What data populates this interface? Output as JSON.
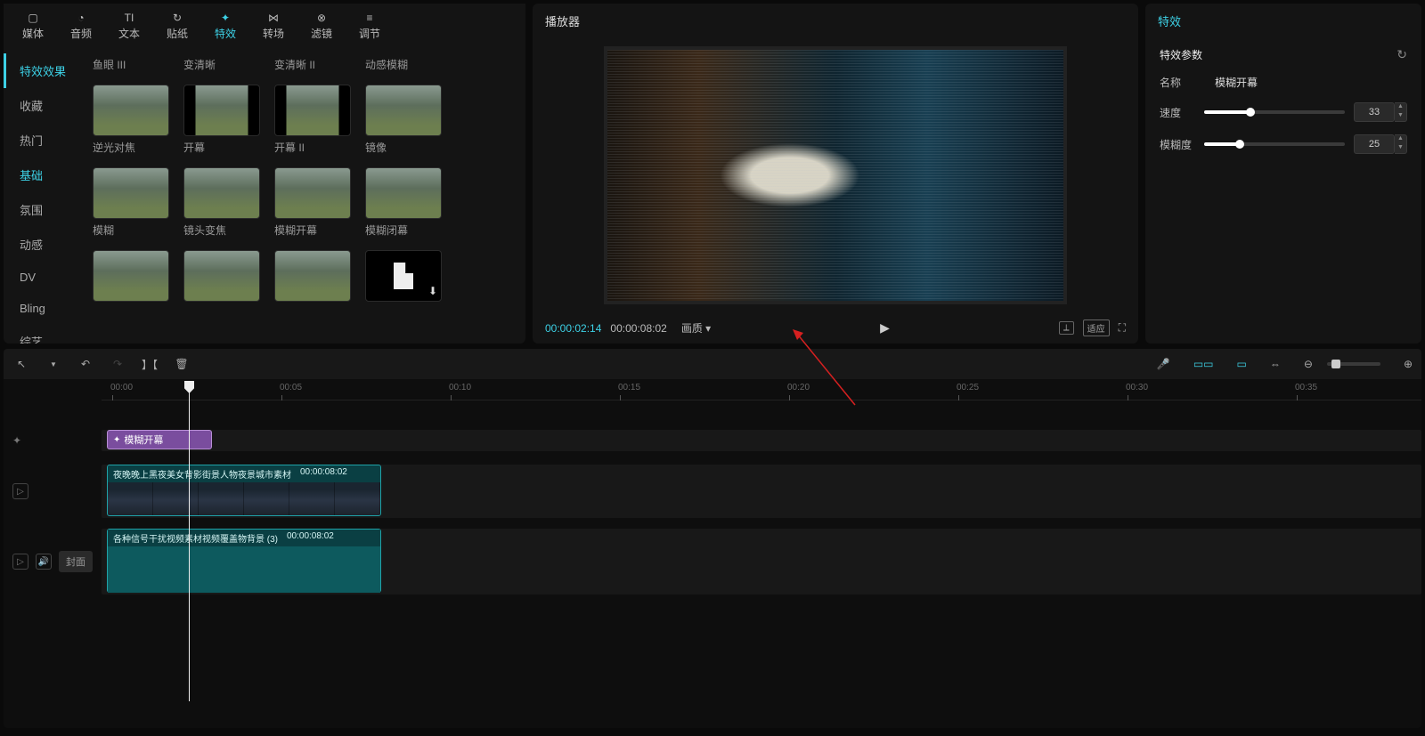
{
  "topTabs": [
    {
      "label": "媒体",
      "icon": "▷"
    },
    {
      "label": "音频",
      "icon": "◔"
    },
    {
      "label": "文本",
      "icon": "TI"
    },
    {
      "label": "贴纸",
      "icon": "↻"
    },
    {
      "label": "特效",
      "icon": "✦",
      "active": true
    },
    {
      "label": "转场",
      "icon": "⋈"
    },
    {
      "label": "滤镜",
      "icon": "⊗"
    },
    {
      "label": "调节",
      "icon": "≡"
    }
  ],
  "sidebarCats": [
    {
      "label": "特效效果",
      "mode": "active"
    },
    {
      "label": "收藏"
    },
    {
      "label": "热门"
    },
    {
      "label": "基础",
      "mode": "current"
    },
    {
      "label": "氛围"
    },
    {
      "label": "动感"
    },
    {
      "label": "DV"
    },
    {
      "label": "Bling"
    },
    {
      "label": "综艺"
    }
  ],
  "effects": {
    "row0": [
      "鱼眼 III",
      "变清晰",
      "变清晰 II",
      "动感模糊"
    ],
    "row1": [
      "逆光对焦",
      "开幕",
      "开幕 II",
      "镜像"
    ],
    "row2": [
      "模糊",
      "镜头变焦",
      "模糊开幕",
      "模糊闭幕"
    ]
  },
  "player": {
    "title": "播放器",
    "currentTime": "00:00:02:14",
    "totalTime": "00:00:08:02",
    "quality": "画质 ▾",
    "fitLabel": "适应"
  },
  "rightPanel": {
    "title": "特效",
    "paramsTitle": "特效参数",
    "nameLabel": "名称",
    "nameValue": "模糊开幕",
    "speedLabel": "速度",
    "speedValue": "33",
    "speedPercent": 33,
    "blurLabel": "模糊度",
    "blurValue": "25",
    "blurPercent": 25
  },
  "ruler": [
    "00:00",
    "00:05",
    "00:10",
    "00:15",
    "00:20",
    "00:25",
    "00:30",
    "00:35"
  ],
  "timeline": {
    "effectClipLabel": "模糊开幕",
    "videoClipName": "夜晚晚上黑夜美女背影街景人物夜景城市素材",
    "videoClipDur": "00:00:08:02",
    "audioClipName": "各种信号干扰视频素材视频覆盖物背景 (3)",
    "audioClipDur": "00:00:08:02",
    "coverLabel": "封面"
  }
}
